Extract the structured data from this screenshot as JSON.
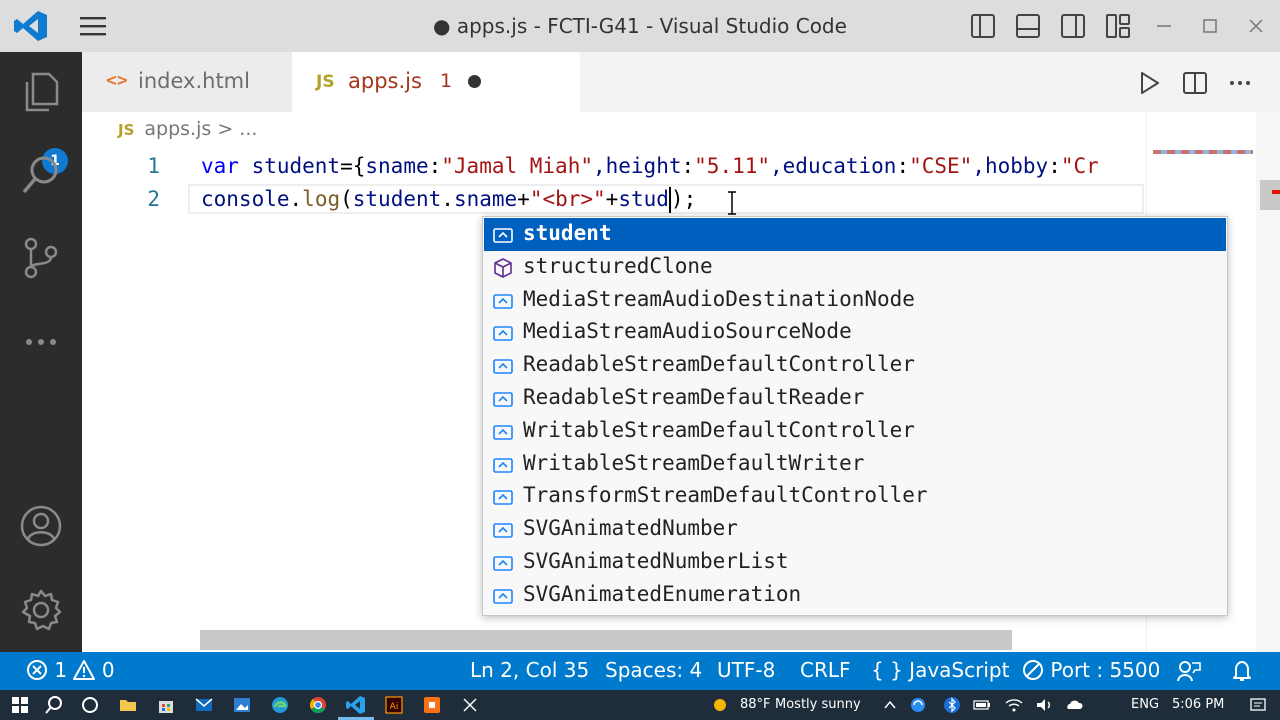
{
  "window": {
    "title": "● apps.js - FCTI-G41 - Visual Studio Code"
  },
  "activity_bar": {
    "explorer_badge": "1"
  },
  "tabs": [
    {
      "label": "index.html",
      "icon": "html-icon"
    },
    {
      "label": "apps.js",
      "icon": "js-icon",
      "problems": "1",
      "dirty": true
    }
  ],
  "breadcrumb": {
    "file_icon": "JS",
    "file": "apps.js",
    "separator": ">",
    "more": "..."
  },
  "editor": {
    "line_numbers": [
      "1",
      "2"
    ],
    "line1": {
      "kw": "var ",
      "ident": "student",
      "p1": "={",
      "k1": "sname",
      "c1": ":",
      "v1": "\"Jamal Miah\"",
      "k2": ",height",
      "c2": ":",
      "v2": "\"5.11\"",
      "k3": ",education",
      "c3": ":",
      "v3": "\"CSE\"",
      "k4": ",hobby",
      "c4": ":",
      "v4": "\"Cr"
    },
    "line2": {
      "obj": "console",
      "dot": ".",
      "fn": "log",
      "paren": "(",
      "arg1": "student",
      "dot2": ".",
      "prop": "sname",
      "plus1": "+",
      "str": "\"<br>\"",
      "plus2": "+",
      "partial": "stud",
      "close": ")",
      "semi": ";"
    }
  },
  "suggestions": [
    {
      "label": "student",
      "icon": "variable-icon",
      "selected": true
    },
    {
      "label": "structuredClone",
      "icon": "method-cube-icon"
    },
    {
      "label": "MediaStreamAudioDestinationNode",
      "icon": "variable-icon"
    },
    {
      "label": "MediaStreamAudioSourceNode",
      "icon": "variable-icon"
    },
    {
      "label": "ReadableStreamDefaultController",
      "icon": "variable-icon"
    },
    {
      "label": "ReadableStreamDefaultReader",
      "icon": "variable-icon"
    },
    {
      "label": "WritableStreamDefaultController",
      "icon": "variable-icon"
    },
    {
      "label": "WritableStreamDefaultWriter",
      "icon": "variable-icon"
    },
    {
      "label": "TransformStreamDefaultController",
      "icon": "variable-icon"
    },
    {
      "label": "SVGAnimatedNumber",
      "icon": "variable-icon"
    },
    {
      "label": "SVGAnimatedNumberList",
      "icon": "variable-icon"
    },
    {
      "label": "SVGAnimatedEnumeration",
      "icon": "variable-icon"
    }
  ],
  "status_bar": {
    "errors": "1",
    "warnings": "0",
    "position": "Ln 2, Col 35",
    "spaces": "Spaces: 4",
    "encoding": "UTF-8",
    "eol": "CRLF",
    "language_braces": "{ }",
    "language": "JavaScript",
    "port": "Port : 5500"
  },
  "taskbar": {
    "weather_temp": "88°F",
    "weather_desc": "Mostly sunny",
    "language": "ENG",
    "time": "5:06 PM"
  },
  "colors": {
    "status_bar": "#007acc",
    "activity_bar": "#2c2c2c",
    "selection": "#0060c0",
    "string": "#a31515",
    "keyword": "#0000ff"
  }
}
